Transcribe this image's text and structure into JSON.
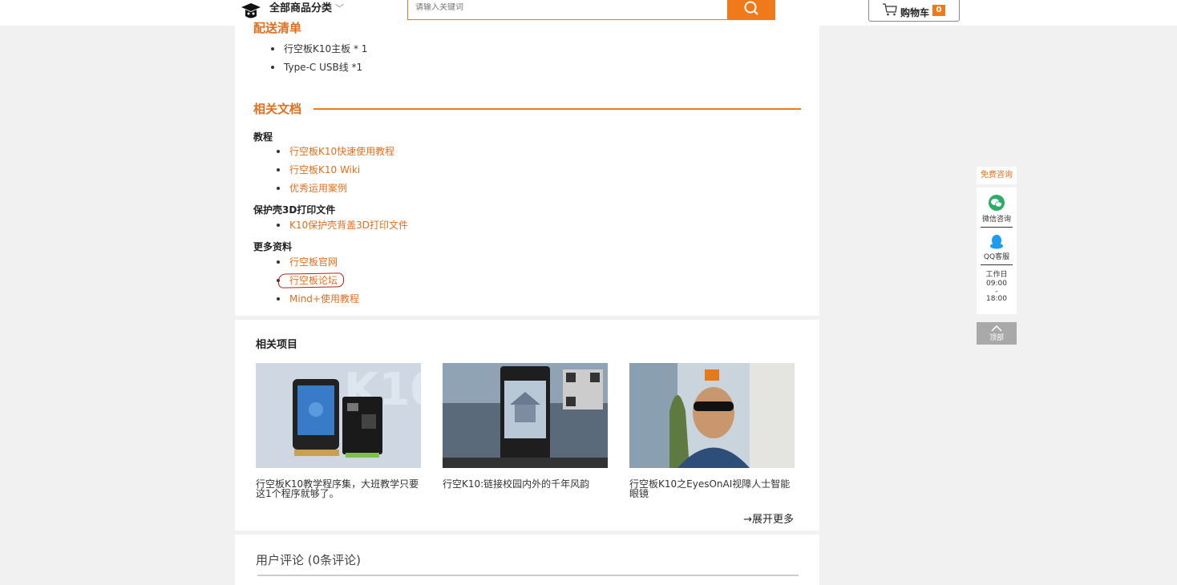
{
  "header": {
    "category_label": "全部商品分类",
    "search_placeholder": "请输入关键词",
    "cart_label": "购物车",
    "cart_count": "0"
  },
  "packing": {
    "heading_partial": "配送清单",
    "items": [
      "行空板K10主板 * 1",
      "Type-C USB线 *1"
    ]
  },
  "docs": {
    "heading": "相关文档",
    "sections": [
      {
        "title": "教程",
        "links": [
          "行空板K10快速使用教程",
          "行空板K10 Wiki",
          "优秀运用案例"
        ]
      },
      {
        "title": "保护壳3D打印文件",
        "links": [
          "K10保护壳背盖3D打印文件"
        ]
      },
      {
        "title": "更多资料",
        "links": [
          "行空板官网",
          "行空板论坛",
          "Mind+使用教程"
        ]
      }
    ]
  },
  "projects": {
    "title": "相关项目",
    "items": [
      {
        "caption_line1": "行空板K10教学程序集，大班教学只要",
        "caption_line2": "这1个程序就够了。"
      },
      {
        "caption_line1": "行空K10:链接校园内外的千年风韵",
        "caption_line2": ""
      },
      {
        "caption_line1": "行空板K10之EyesOnAI视障人士智能",
        "caption_line2": "眼镜"
      }
    ],
    "more_label": "→展开更多",
    "thumb_text": "K10"
  },
  "comments": {
    "label": "用户评论 (0条评论)"
  },
  "float_bar": {
    "free_consult": "免费咨询",
    "wechat": "微信咨询",
    "qq": "QQ客服",
    "work_label": "工作日",
    "work_start": "09:00",
    "work_sep": "-",
    "work_end": "18:00",
    "top_label": "顶部"
  },
  "colors": {
    "accent": "#f07a1a",
    "link": "#e46e1c",
    "background": "#f1f1f1"
  }
}
